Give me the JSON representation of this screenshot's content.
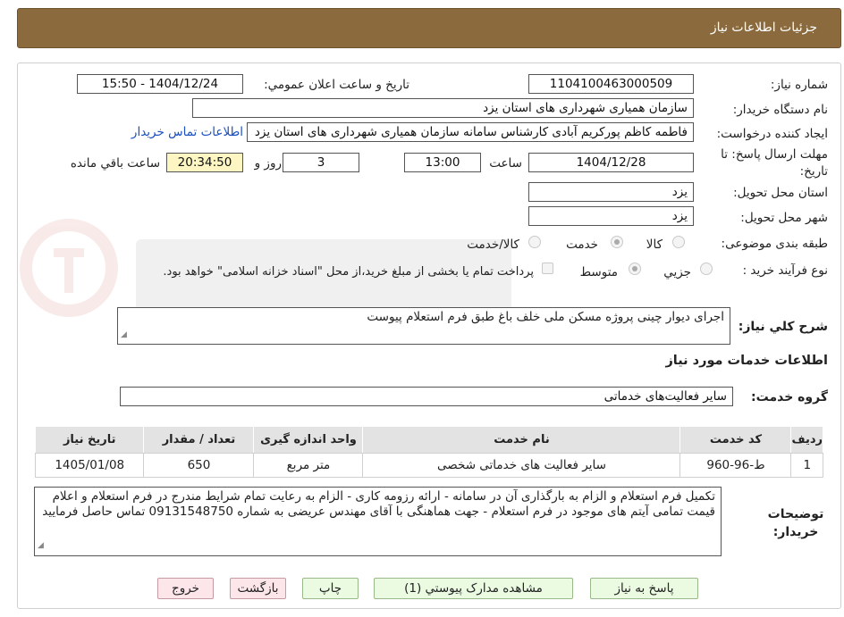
{
  "header": {
    "title": "جزئیات اطلاعات نیاز"
  },
  "fields": {
    "need_number_label": "شماره نیاز:",
    "need_number": "1104100463000509",
    "announce_label": "تاریخ و ساعت اعلان عمومي:",
    "announce_value": "1404/12/24 - 15:50",
    "buyer_org_label": "نام دستگاه خریدار:",
    "buyer_org": "سازمان همیاری شهرداری های استان یزد",
    "requester_label": "ایجاد کننده درخواست:",
    "requester": "فاطمه کاظم پورکریم آبادی کارشناس سامانه سازمان همیاری شهرداری های استان یزد",
    "contact_link": "اطلاعات تماس خريدار",
    "deadline_label_1": "مهلت ارسال پاسخ: تا",
    "deadline_label_2": "تاریخ:",
    "deadline_date": "1404/12/28",
    "time_label": "ساعت",
    "deadline_time": "13:00",
    "days_value": "3",
    "days_label": "روز و",
    "remaining_time": "20:34:50",
    "remaining_label": "ساعت باقي مانده",
    "province_label": "استان محل تحویل:",
    "province": "یزد",
    "city_label": "شهر محل تحویل:",
    "city": "یزد",
    "category_label": "طبقه بندی موضوعی:",
    "category_options": [
      "كالا",
      "خدمت",
      "كالا/خدمت"
    ],
    "process_label": "نوع فرآیند خرید :",
    "process_options": [
      "جزيي",
      "متوسط"
    ],
    "payment_note": "پرداخت تمام یا بخشی از مبلغ خرید،از محل \"اسناد خزانه اسلامی\" خواهد بود.",
    "description_label": "شرح کلي نياز:",
    "description": "اجرای دیوار چینی پروژه مسکن ملی خلف باغ طبق فرم استعلام پیوست",
    "services_title": "اطلاعات خدمات مورد نياز",
    "service_group_label": "گروه خدمت:",
    "service_group": "سایر فعالیت‌های خدماتی"
  },
  "table": {
    "headers": [
      "رديف",
      "كد خدمت",
      "نام خدمت",
      "واحد اندازه گیری",
      "تعداد / مقدار",
      "تاريخ نياز"
    ],
    "rows": [
      [
        "1",
        "ط-96-960",
        "سایر فعالیت های خدماتی شخصی",
        "متر مربع",
        "650",
        "1405/01/08"
      ]
    ]
  },
  "buyer_notes_label": "توضیحات خریدار:",
  "buyer_notes": "تکمیل فرم استعلام و الزام به بارگذاری آن در سامانه - ارائه رزومه کاری - الزام به رعایت تمام شرایط مندرج در فرم استعلام و اعلام قیمت تمامی آیتم های موجود در فرم استعلام - جهت هماهنگی با آقای مهندس عریضی  به شماره 09131548750 تماس حاصل فرمایید",
  "buttons": {
    "respond": "پاسخ به نياز",
    "attachments": "مشاهده مدارک پیوستي (1)",
    "print": "چاپ",
    "back": "بازگشت",
    "exit": "خروج"
  },
  "colors": {
    "header_bg": "#8b6a3e",
    "remaining_bg": "#fdf6c3",
    "green_btn": "#eafbe2",
    "pink_btn": "#fde6ea"
  }
}
